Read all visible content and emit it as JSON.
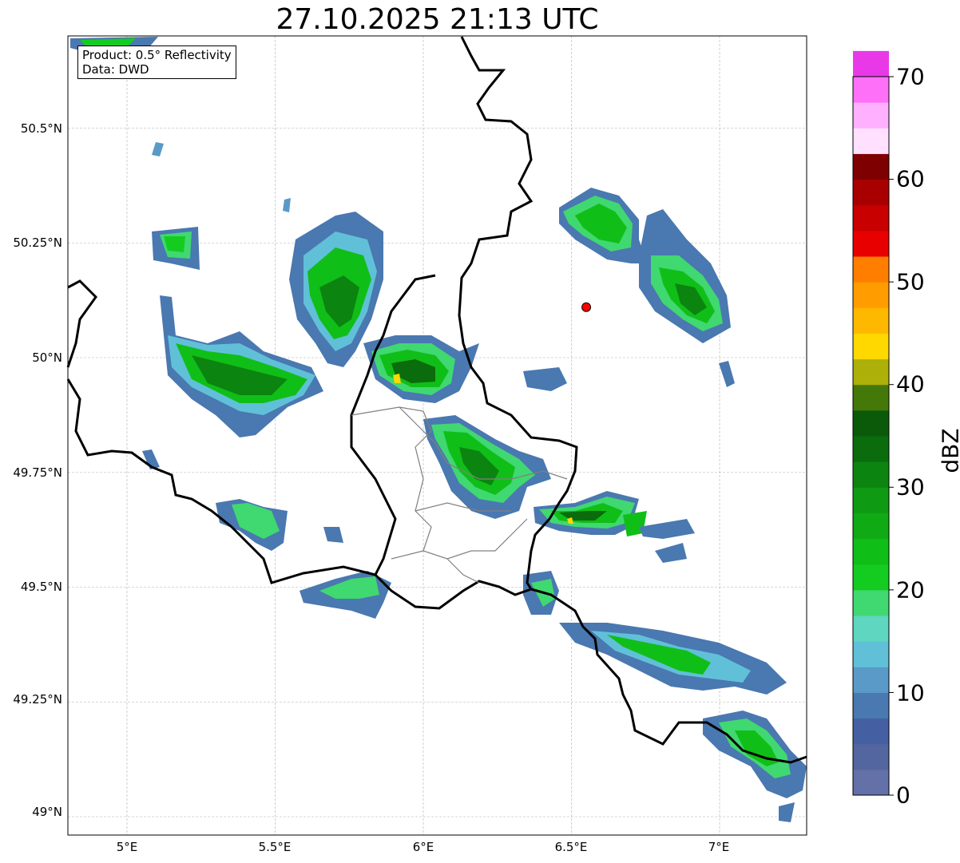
{
  "title": "27.10.2025 21:13 UTC",
  "info_box": {
    "product": "Product: 0.5° Reflectivity",
    "data": "Data: DWD"
  },
  "lat_labels": [
    "50.5°N",
    "50.25°N",
    "50°N",
    "49.75°N",
    "49.5°N",
    "49.25°N",
    "49°N"
  ],
  "lon_labels": [
    "5°E",
    "5.5°E",
    "6°E",
    "6.5°E",
    "7°E"
  ],
  "colorbar": {
    "label": "dBZ",
    "ticks": [
      "0",
      "10",
      "20",
      "30",
      "40",
      "50",
      "60",
      "70"
    ],
    "min": 0,
    "max": 70,
    "step": 2.5,
    "colors": [
      "#6470a8",
      "#5466a0",
      "#4460a2",
      "#4a78b0",
      "#5a9ac8",
      "#60c0d8",
      "#5ed6c0",
      "#40d870",
      "#14cc20",
      "#10be18",
      "#10aa14",
      "#0e9a12",
      "#0c8410",
      "#0a6c0c",
      "#0a5a0a",
      "#447808",
      "#acb008",
      "#ffd800",
      "#ffb800",
      "#ff9c00",
      "#ff7e00",
      "#e80000",
      "#c80000",
      "#a80000",
      "#7e0000",
      "#ffe0ff",
      "#ffb0ff",
      "#ff70f8",
      "#e838e8"
    ]
  },
  "marker": {
    "lon": 6.55,
    "lat": 50.11,
    "color": "#ff0000"
  }
}
